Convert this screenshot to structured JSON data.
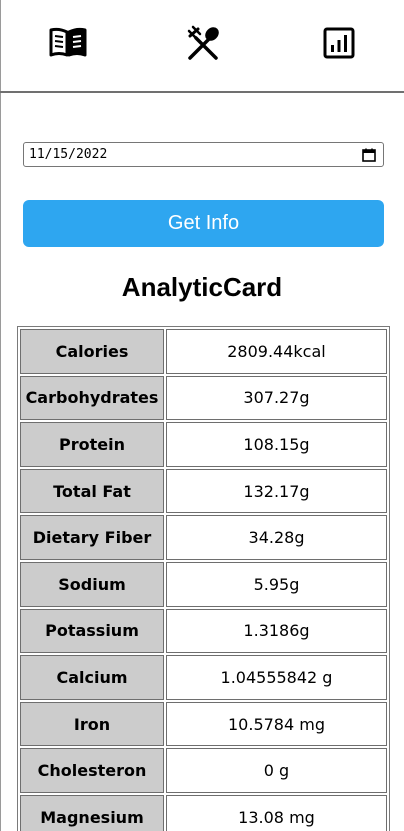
{
  "nav": {
    "items": [
      {
        "icon": "book-icon"
      },
      {
        "icon": "fork-spoon-icon"
      },
      {
        "icon": "analytics-icon"
      }
    ]
  },
  "date_input": {
    "value": "11/15/2022",
    "icon": "calendar-icon"
  },
  "get_info_button": {
    "label": "Get Info",
    "color": "#2ea6f0"
  },
  "card": {
    "title": "AnalyticCard",
    "rows": [
      {
        "label": "Calories",
        "value": "2809.44kcal"
      },
      {
        "label": "Carbohydrates",
        "value": "307.27g"
      },
      {
        "label": "Protein",
        "value": "108.15g"
      },
      {
        "label": "Total Fat",
        "value": "132.17g"
      },
      {
        "label": "Dietary Fiber",
        "value": "34.28g"
      },
      {
        "label": "Sodium",
        "value": "5.95g"
      },
      {
        "label": "Potassium",
        "value": "1.3186g"
      },
      {
        "label": "Calcium",
        "value": "1.04555842 g"
      },
      {
        "label": "Iron",
        "value": "10.5784 mg"
      },
      {
        "label": "Cholesteron",
        "value": "0 g"
      },
      {
        "label": "Magnesium",
        "value": "13.08 mg"
      }
    ]
  }
}
